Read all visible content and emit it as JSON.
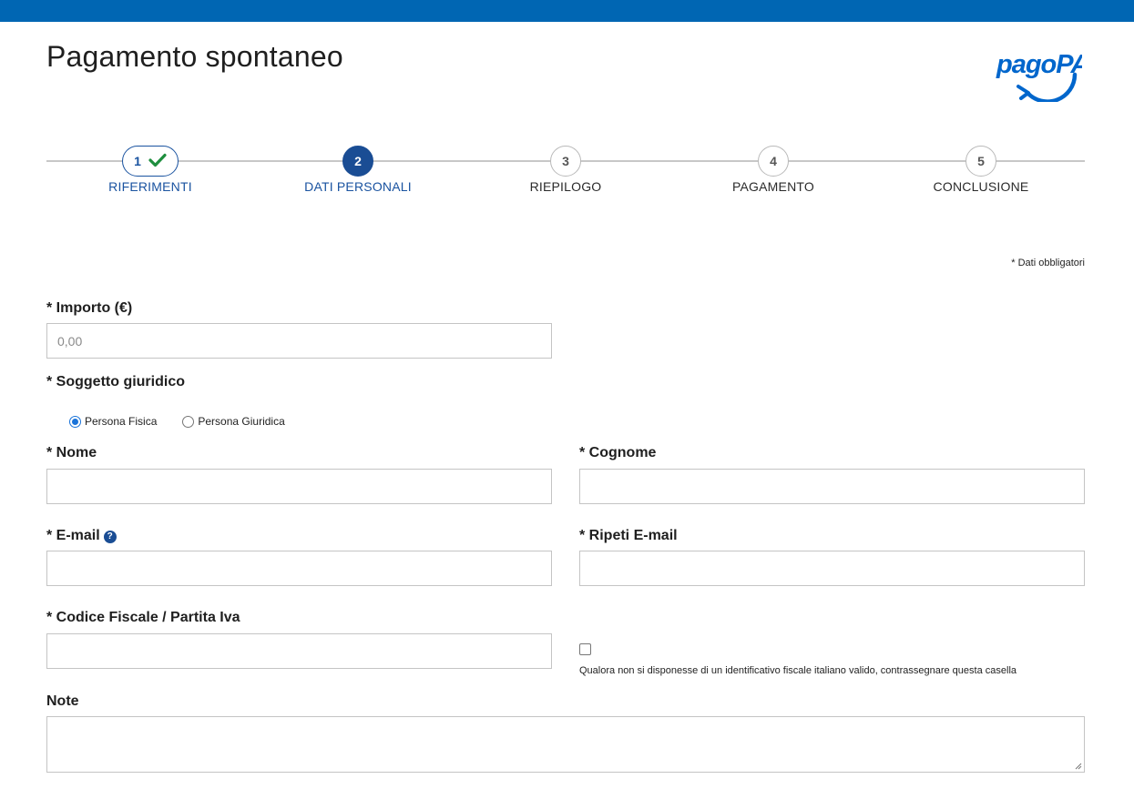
{
  "page": {
    "title": "Pagamento spontaneo"
  },
  "logo": {
    "text": "pagoPA",
    "color": "#0066cc"
  },
  "colors": {
    "topbar": "#0066b3",
    "accent": "#1a4d94",
    "check": "#1e8e3e"
  },
  "stepper": {
    "steps": [
      {
        "number": "1",
        "label": "RIFERIMENTI",
        "state": "done",
        "icon": "check-icon"
      },
      {
        "number": "2",
        "label": "DATI PERSONALI",
        "state": "active"
      },
      {
        "number": "3",
        "label": "RIEPILOGO",
        "state": "pending"
      },
      {
        "number": "4",
        "label": "PAGAMENTO",
        "state": "pending"
      },
      {
        "number": "5",
        "label": "CONCLUSIONE",
        "state": "pending"
      }
    ]
  },
  "form": {
    "required_note": "* Dati obbligatori",
    "importo": {
      "label": "* Importo (€)",
      "value": "",
      "placeholder": "0,00"
    },
    "soggetto": {
      "label": "* Soggetto giuridico",
      "options": [
        {
          "label": "Persona Fisica",
          "checked": true
        },
        {
          "label": "Persona Giuridica",
          "checked": false
        }
      ]
    },
    "nome": {
      "label": "* Nome",
      "value": ""
    },
    "cognome": {
      "label": "* Cognome",
      "value": ""
    },
    "email": {
      "label": "* E-mail",
      "value": "",
      "help_icon": "question-circle-icon",
      "help_glyph": "?"
    },
    "ripeti_email": {
      "label": "* Ripeti E-mail",
      "value": ""
    },
    "codice_fiscale": {
      "label": "* Codice Fiscale / Partita Iva",
      "value": ""
    },
    "no_codice_fiscale": {
      "label": "Qualora non si disponesse di un identificativo fiscale italiano valido, contrassegnare questa casella",
      "checked": false
    },
    "note": {
      "label": "Note",
      "value": ""
    }
  }
}
